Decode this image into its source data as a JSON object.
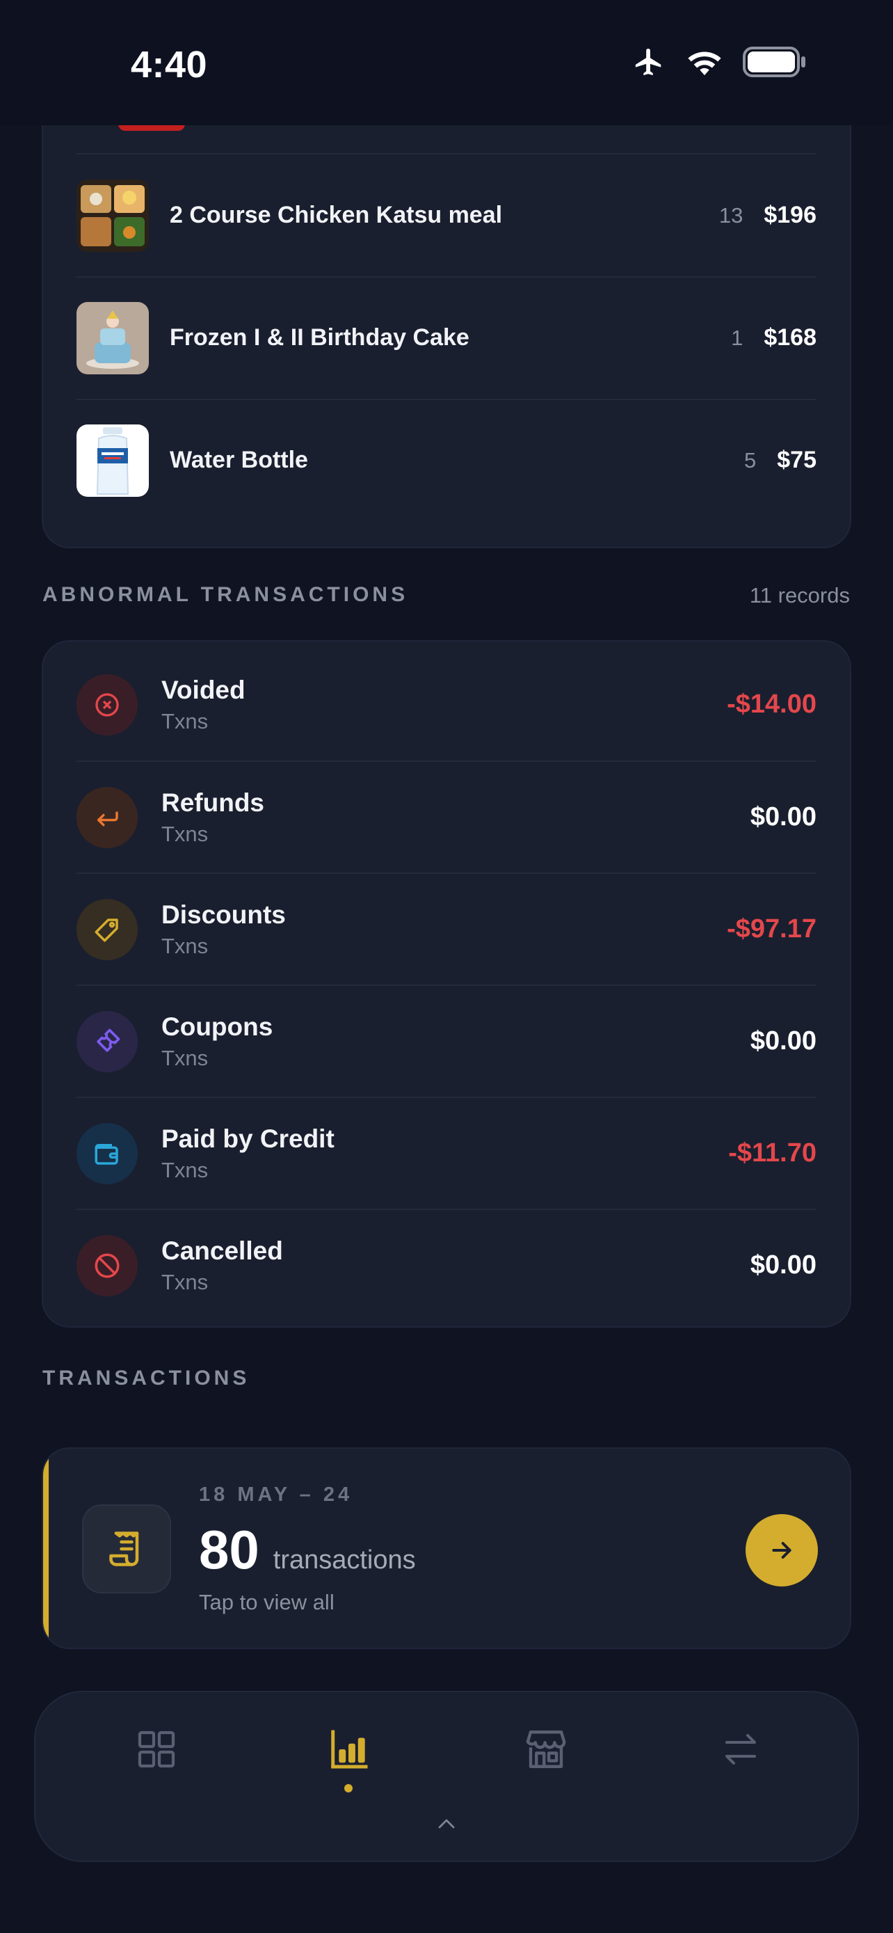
{
  "status_bar": {
    "time": "4:40"
  },
  "top_products": [
    {
      "name": "2 Course Chicken Katsu meal",
      "qty": "13",
      "price": "$196"
    },
    {
      "name": "Frozen I & II Birthday Cake",
      "qty": "1",
      "price": "$168"
    },
    {
      "name": "Water Bottle",
      "qty": "5",
      "price": "$75"
    }
  ],
  "abnormal": {
    "title": "ABNORMAL TRANSACTIONS",
    "records": "11 records",
    "rows": [
      {
        "label": "Voided",
        "sub": "Txns",
        "amount": "-$14.00",
        "icon": "x-circle-icon",
        "color": "#e5474b"
      },
      {
        "label": "Refunds",
        "sub": "Txns",
        "amount": "$0.00",
        "icon": "return-arrow-icon",
        "color": "#e8772e"
      },
      {
        "label": "Discounts",
        "sub": "Txns",
        "amount": "-$97.17",
        "icon": "tag-icon",
        "color": "#d4ad2e"
      },
      {
        "label": "Coupons",
        "sub": "Txns",
        "amount": "$0.00",
        "icon": "ticket-icon",
        "color": "#7c5cf0"
      },
      {
        "label": "Paid by Credit",
        "sub": "Txns",
        "amount": "-$11.70",
        "icon": "wallet-icon",
        "color": "#2aa7d9"
      },
      {
        "label": "Cancelled",
        "sub": "Txns",
        "amount": "$0.00",
        "icon": "ban-icon",
        "color": "#e5474b"
      }
    ]
  },
  "transactions": {
    "title": "TRANSACTIONS",
    "date_range": "18 MAY – 24",
    "count": "80",
    "unit": "transactions",
    "hint": "Tap to view all",
    "accent": "#d4ad2e"
  },
  "bottom_nav": {
    "items": [
      "grid-icon",
      "bar-chart-icon",
      "store-icon",
      "swap-arrows-icon"
    ],
    "active": "bar-chart-icon"
  }
}
